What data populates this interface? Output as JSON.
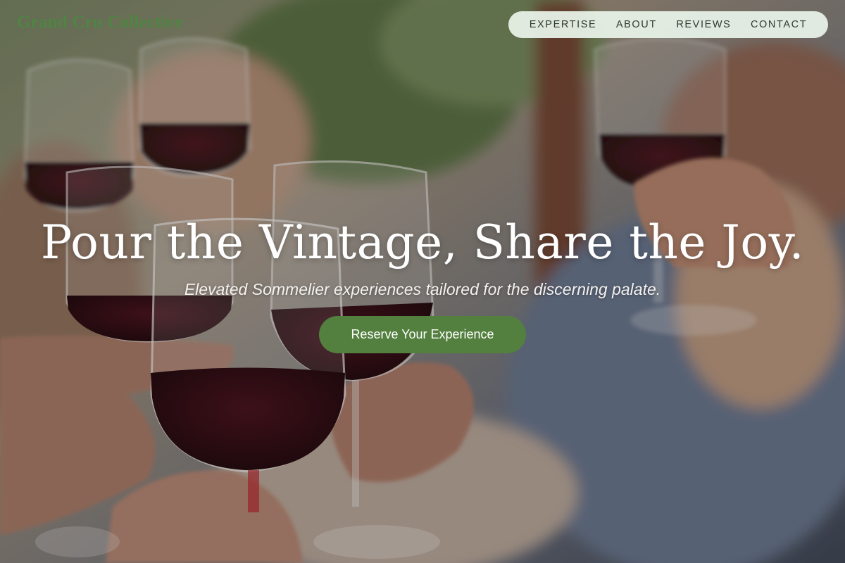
{
  "brand": {
    "name": "Grand Cru Collective",
    "color": "#4f8543"
  },
  "nav": {
    "items": [
      {
        "label": "EXPERTISE"
      },
      {
        "label": "ABOUT"
      },
      {
        "label": "REVIEWS"
      },
      {
        "label": "CONTACT"
      }
    ]
  },
  "hero": {
    "headline": "Pour the Vintage, Share the Joy.",
    "subheadline": "Elevated Sommelier experiences tailored for the discerning palate.",
    "cta_label": "Reserve Your Experience",
    "cta_color": "#53803f",
    "background_image": "friends toasting red wine glasses outdoors"
  }
}
